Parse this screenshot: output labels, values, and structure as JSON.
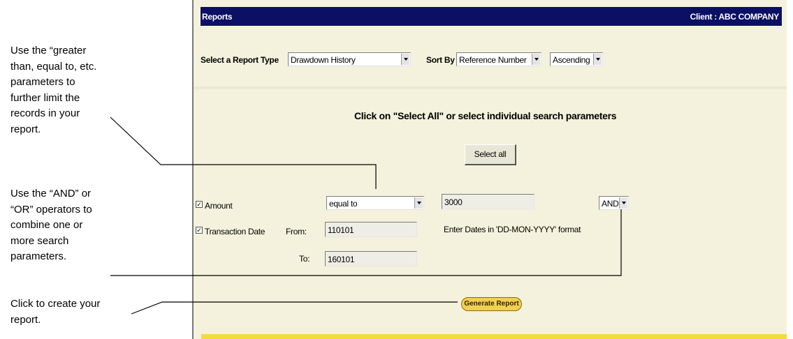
{
  "annotations": {
    "greater_than": [
      "Use the “greater",
      "than, equal to, etc.",
      "parameters to",
      "further limit the",
      "records in your",
      "report."
    ],
    "and_or": [
      "Use the “AND” or",
      "“OR” operators to",
      "combine one or",
      "more search",
      "parameters."
    ],
    "create": [
      "Click to create your",
      "report."
    ]
  },
  "header": {
    "title": "Reports",
    "client": "Client : ABC COMPANY"
  },
  "report_type": {
    "label": "Select a Report Type",
    "value": "Drawdown History"
  },
  "sort": {
    "label": "Sort By",
    "field": "Reference Number",
    "order": "Ascending"
  },
  "instructions": "Click on \"Select All\" or select individual search parameters",
  "select_all_label": "Select all",
  "amount": {
    "label": "Amount",
    "checked": true,
    "operator": "equal to",
    "value": "3000",
    "connector": "AND"
  },
  "transaction_date": {
    "label": "Transaction Date",
    "checked": true,
    "from_label": "From:",
    "from_value": "110101",
    "to_label": "To:",
    "to_value": "160101",
    "hint": "Enter Dates in 'DD-MON-YYYY' format"
  },
  "generate_label": "Generate Report",
  "colors": {
    "header_bg": "#0c1064",
    "panel_bg": "#f4f2dc",
    "accent_yellow": "#f2dc3a"
  }
}
